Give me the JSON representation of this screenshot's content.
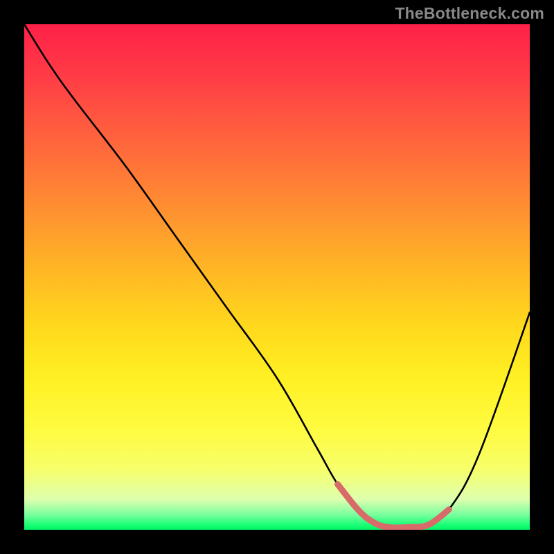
{
  "watermark": "TheBottleneck.com",
  "chart_data": {
    "type": "line",
    "title": "",
    "xlabel": "",
    "ylabel": "",
    "xlim": [
      0,
      100
    ],
    "ylim": [
      0,
      100
    ],
    "grid": false,
    "legend": false,
    "series": [
      {
        "name": "bottleneck-curve",
        "x": [
          0,
          5,
          10,
          20,
          30,
          40,
          50,
          58,
          62,
          66,
          69,
          72,
          76,
          80,
          84,
          90,
          100
        ],
        "y": [
          100,
          92,
          85,
          72,
          58,
          44,
          30,
          16,
          9,
          4,
          1.5,
          0.5,
          0.5,
          1,
          4,
          15,
          43
        ],
        "color": "#000000"
      },
      {
        "name": "optimal-range",
        "x": [
          62,
          66,
          69,
          72,
          76,
          80,
          84
        ],
        "y": [
          9,
          4,
          1.5,
          0.5,
          0.5,
          1,
          4
        ],
        "color": "#d86a6a",
        "style": "thick"
      }
    ],
    "gradient_stops": [
      {
        "pos": 0,
        "color": "#ff2148"
      },
      {
        "pos": 50,
        "color": "#ffbb23"
      },
      {
        "pos": 80,
        "color": "#fffb40"
      },
      {
        "pos": 100,
        "color": "#00f764"
      }
    ]
  }
}
